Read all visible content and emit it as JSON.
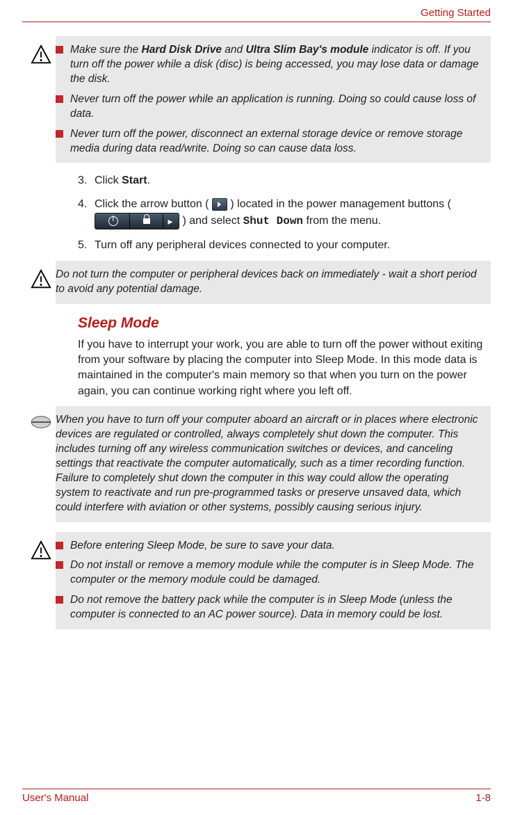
{
  "header": {
    "chapter": "Getting Started"
  },
  "caution1": {
    "items": [
      {
        "pre": "Make sure the ",
        "b1": "Hard Disk Drive",
        "mid": " and ",
        "b2": "Ultra Slim Bay's module",
        "post": " indicator is off. If you turn off the power while a disk (disc) is being accessed, you may lose data or damage the disk."
      },
      {
        "text": "Never turn off the power while an application is running. Doing so could cause loss of data."
      },
      {
        "text": "Never turn off the power, disconnect an external storage device or remove storage media during data read/write. Doing so can cause data loss."
      }
    ]
  },
  "steps": {
    "s3_num": "3.",
    "s3_a": "Click ",
    "s3_b": "Start",
    "s3_c": ".",
    "s4_num": "4.",
    "s4_a": "Click the arrow button ( ",
    "s4_b": " ) located in the power management buttons ( ",
    "s4_c": " ) and select ",
    "s4_d": "Shut Down",
    "s4_e": " from the menu.",
    "s5_num": "5.",
    "s5": "Turn off any peripheral devices connected to your computer."
  },
  "caution2": {
    "text": "Do not turn the computer or peripheral devices back on immediately - wait a short period to avoid any potential damage."
  },
  "sleep": {
    "heading": "Sleep Mode",
    "intro": "If you have to interrupt your work, you are able to turn off the power without exiting from your software by placing the computer into Sleep Mode. In this mode data is maintained in the computer's main memory so that when you turn on the power again, you can continue working right where you left off."
  },
  "note": {
    "text": "When you have to turn off your computer aboard an aircraft or in places where electronic devices are regulated or controlled, always completely shut down the computer. This includes turning off any wireless communication switches or devices, and canceling settings that reactivate the computer automatically, such as a timer recording function. Failure to completely shut down the computer in this way could allow the operating system to reactivate and run pre-programmed tasks or preserve unsaved data, which could interfere with aviation or other systems, possibly causing serious injury."
  },
  "caution3": {
    "items": [
      "Before entering Sleep Mode, be sure to save your data.",
      "Do not install or remove a memory module while the computer is in Sleep Mode. The computer or the memory module could be damaged.",
      "Do not remove the battery pack while the computer is in Sleep Mode (unless the computer is connected to an AC power source). Data in memory could be lost."
    ]
  },
  "footer": {
    "left": "User's Manual",
    "right": "1-8"
  }
}
